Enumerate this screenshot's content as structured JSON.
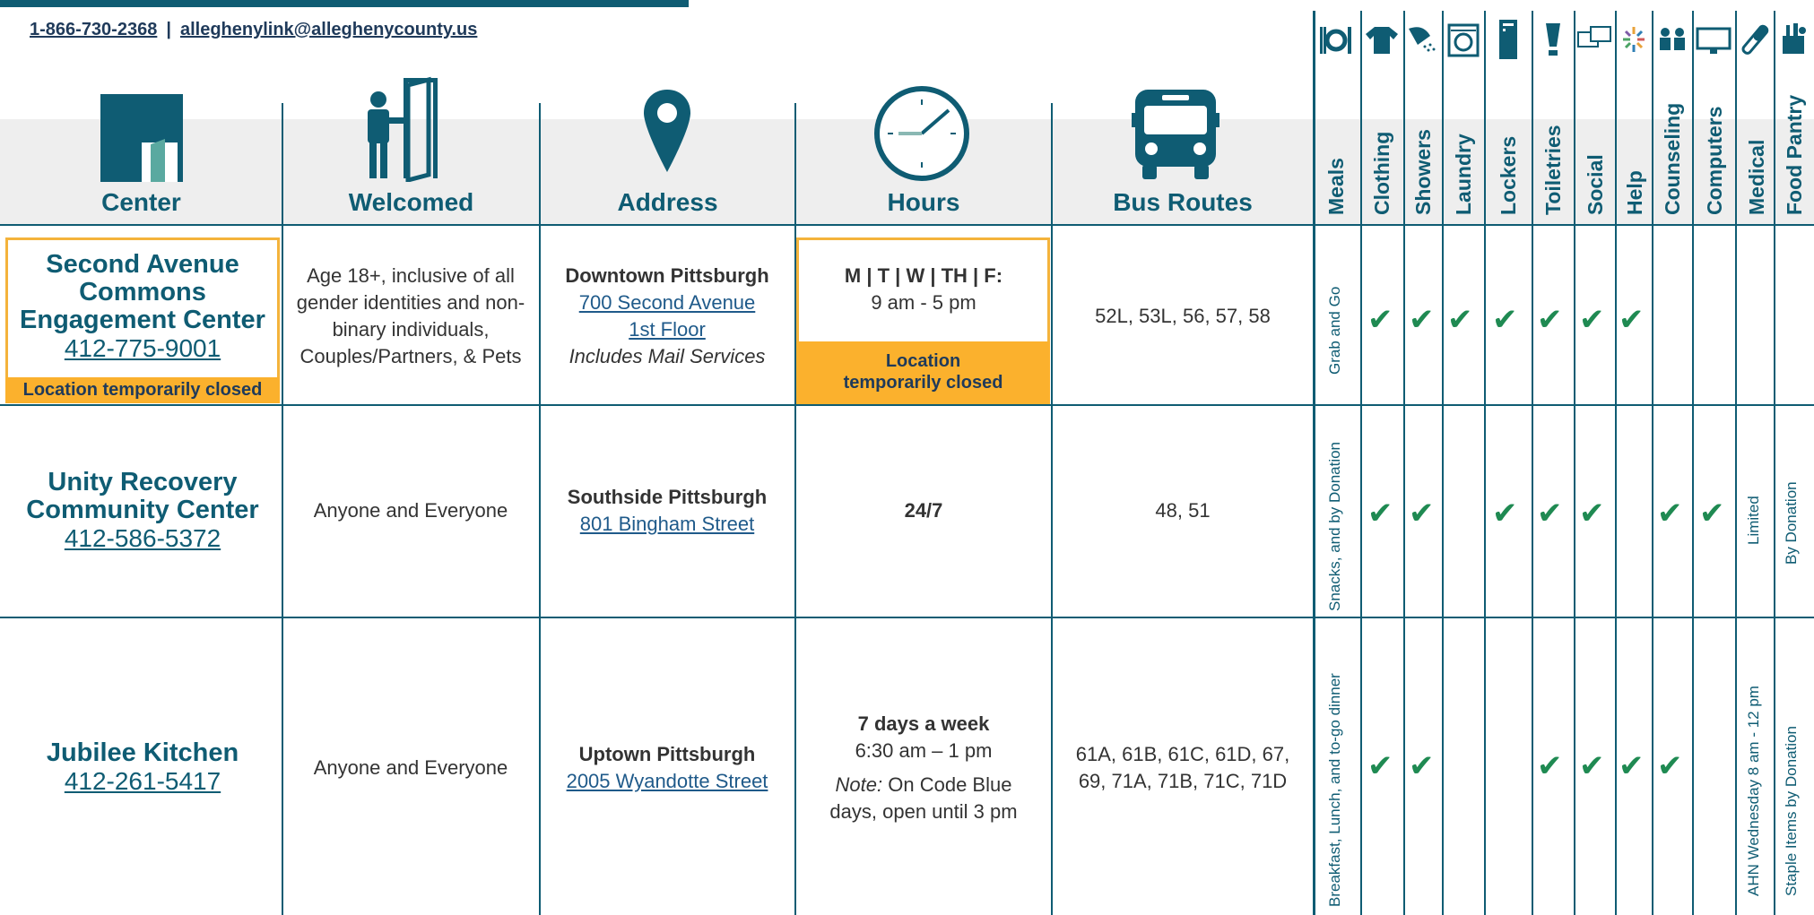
{
  "contact": {
    "phone": "1-866-730-2368",
    "separator": "|",
    "email": "alleghenylink@alleghenycounty.us"
  },
  "columns": {
    "center": "Center",
    "welcomed": "Welcomed",
    "address": "Address",
    "hours": "Hours",
    "bus_routes": "Bus Routes"
  },
  "services": [
    {
      "label": "Meals",
      "icon": "meals-icon"
    },
    {
      "label": "Clothing",
      "icon": "clothing-icon"
    },
    {
      "label": "Showers",
      "icon": "shower-icon"
    },
    {
      "label": "Laundry",
      "icon": "laundry-icon"
    },
    {
      "label": "Lockers",
      "icon": "locker-icon"
    },
    {
      "label": "Toiletries",
      "icon": "toiletries-icon"
    },
    {
      "label": "Social",
      "icon": "social-icon"
    },
    {
      "label": "Help",
      "icon": "help-icon"
    },
    {
      "label": "Counseling",
      "icon": "counseling-icon"
    },
    {
      "label": "Computers",
      "icon": "computer-icon"
    },
    {
      "label": "Medical",
      "icon": "medical-icon"
    },
    {
      "label": "Food Pantry",
      "icon": "food-pantry-icon"
    }
  ],
  "rows": [
    {
      "name": "Second Avenue Commons Engagement Center",
      "phone": "412-775-9001",
      "closed_note": "Location temporarily closed",
      "welcomed": "Age 18+, inclusive of all gender identities and non-binary individuals, Couples/Partners, & Pets",
      "area": "Downtown Pittsburgh",
      "street": "700 Second Avenue",
      "unit": "1st Floor",
      "address_note": "Includes Mail Services",
      "hours_days": "M | T | W | TH | F:",
      "hours_time": "9 am - 5 pm",
      "hours_closed": "Location temporarily closed",
      "bus": "52L, 53L, 56, 57, 58",
      "meals_note": "Grab and Go",
      "checks": [
        false,
        true,
        true,
        true,
        true,
        true,
        true,
        true,
        false,
        false,
        false,
        false
      ]
    },
    {
      "name": "Unity Recovery Community Center",
      "phone": "412-586-5372",
      "welcomed": "Anyone and Everyone",
      "area": "Southside Pittsburgh",
      "street": "801 Bingham Street",
      "hours_days": "24/7",
      "bus": "48, 51",
      "meals_note": "Snacks, and by Donation",
      "medical_note": "Limited",
      "pantry_note": "By Donation",
      "checks": [
        false,
        true,
        true,
        false,
        true,
        true,
        true,
        false,
        true,
        true,
        false,
        false
      ]
    },
    {
      "name": "Jubilee Kitchen",
      "phone": "412-261-5417",
      "welcomed": "Anyone and Everyone",
      "area": "Uptown Pittsburgh",
      "street": "2005 Wyandotte Street",
      "hours_days": "7 days a week",
      "hours_time": "6:30 am – 1 pm",
      "hours_note_label": "Note:",
      "hours_note": "On Code Blue days, open until 3 pm",
      "bus": "61A, 61B, 61C, 61D, 67, 69, 71A, 71B, 71C, 71D",
      "meals_note": "Breakfast, Lunch, and to-go dinner",
      "medical_note": "AHN Wednesday 8 am - 12 pm",
      "pantry_note": "Staple Items by Donation",
      "checks": [
        false,
        true,
        true,
        false,
        false,
        true,
        true,
        true,
        true,
        false,
        false,
        false
      ]
    }
  ],
  "check_mark": "✔",
  "colors": {
    "teal": "#0f5c73",
    "green": "#1f8a52",
    "closed_yellow": "#fbb12d"
  }
}
